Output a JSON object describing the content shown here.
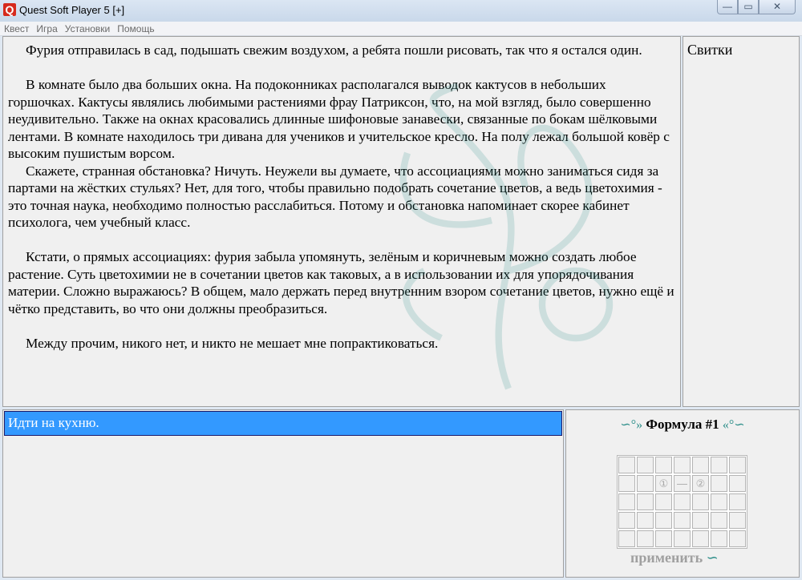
{
  "window": {
    "title": "Quest Soft Player 5 [+]",
    "icon_letter": "Q",
    "buttons": [
      "—",
      "▭",
      "✕"
    ]
  },
  "menu": [
    "Квест",
    "Игра",
    "Установки",
    "Помощь"
  ],
  "story": {
    "paragraphs": [
      {
        "text": "Фурия отправилась в сад, подышать свежим воздухом, а ребята пошли рисовать, так что я остался один.",
        "gap": false
      },
      {
        "text": "В комнате было два больших окна. На подоконниках располагался выводок кактусов в небольших горшочках. Кактусы являлись любимыми растениями фрау Патриксон, что, на мой взгляд, было совершенно неудивительно. Также на окнах красовались длинные шифоновые занавески, связанные по бокам шёлковыми лентами. В комнате находилось три дивана для учеников и учительское кресло. На полу лежал большой ковёр с высоким пушистым ворсом.",
        "gap": true
      },
      {
        "text": "Скажете, странная обстановка? Ничуть. Неужели вы думаете, что ассоциациями можно заниматься сидя за партами на жёстких стульях? Нет, для того, чтобы правильно подобрать сочетание цветов, а ведь цветохимия - это точная наука, необходимо полностью расслабиться. Потому и обстановка напоминает скорее кабинет психолога, чем учебный класс.",
        "gap": false
      },
      {
        "text": "Кстати, о прямых ассоциациях: фурия забыла упомянуть, зелёным и коричневым можно создать любое растение. Суть цветохимии не в сочетании цветов как таковых, а в использовании их для упорядочивания материи. Сложно выражаюсь? В общем, мало держать перед внутренним взором сочетание цветов, нужно ещё и чётко представить, во что они должны преобразиться.",
        "gap": true
      },
      {
        "text": "Между прочим, никого нет, и никто не мешает мне попрактиковаться.",
        "gap": true
      }
    ]
  },
  "side": {
    "title": "Свитки"
  },
  "actions": [
    {
      "label": "Идти на кухню.",
      "selected": true
    }
  ],
  "formula": {
    "title": "Формула #1",
    "curl_left": "∽°»",
    "curl_right": "«°∽",
    "apply_label": "применить",
    "apply_icon": "∽",
    "rows": [
      [
        "",
        "",
        "",
        "",
        "",
        "",
        ""
      ],
      [
        "",
        "",
        "①",
        "—",
        "②",
        "",
        ""
      ],
      [
        "",
        "",
        "",
        "",
        "",
        "",
        ""
      ],
      [
        "",
        "",
        "",
        "",
        "",
        "",
        ""
      ],
      [
        "",
        "",
        "",
        "",
        "",
        "",
        ""
      ]
    ]
  },
  "colors": {
    "selection": "#3399ff",
    "accent": "#2e8f8a"
  }
}
